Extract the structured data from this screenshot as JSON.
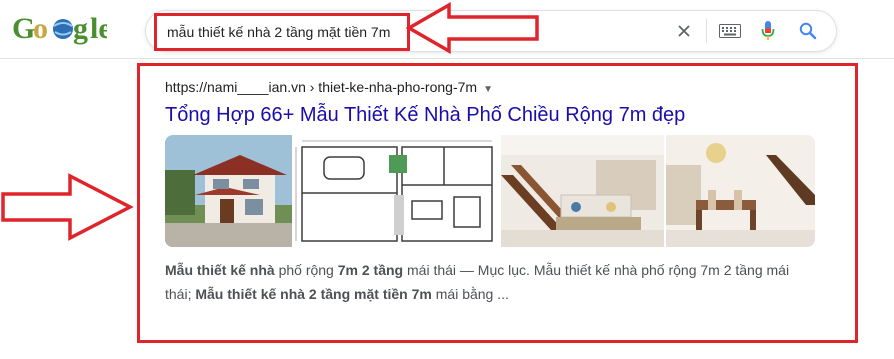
{
  "search": {
    "query": "mẫu thiết kế nhà 2 tầng mặt tiền 7m",
    "clear_icon": "close-icon",
    "keyboard_icon": "keyboard-icon",
    "mic_icon": "microphone-icon",
    "search_icon": "search-icon"
  },
  "result": {
    "cite": "https://nami____ian.vn › thiet-ke-nha-pho-rong-7m",
    "title": "Tổng Hợp 66+ Mẫu Thiết Kế Nhà Phố Chiều Rộng 7m đẹp",
    "thumbnails": [
      "two-storey-house-render",
      "floor-plan-drawing",
      "living-room-staircase",
      "dining-room-staircase"
    ],
    "snippet": {
      "line1_bold1": "Mẫu thiết kế nhà",
      "line1_text1": " phố rộng ",
      "line1_bold2": "7m 2 tầng",
      "line1_text2": " mái thái — Mục lục. Mẫu thiết kế nhà phố rộng 7m 2 tầng mái",
      "line2_text1": "thái; ",
      "line2_bold1": "Mẫu thiết kế nhà 2 tầng mặt tiền 7m",
      "line2_text2": " mái bằng ..."
    }
  },
  "colors": {
    "annotation_red": "#e0242b",
    "link_blue": "#1a0dab"
  }
}
